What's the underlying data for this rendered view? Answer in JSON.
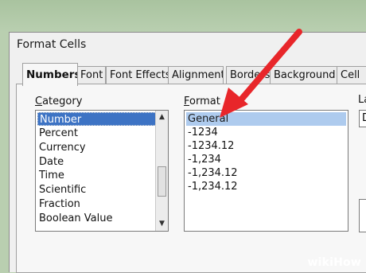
{
  "window": {
    "title": "Format Cells"
  },
  "tabs": [
    {
      "label": "Numbers",
      "active": true
    },
    {
      "label": "Font"
    },
    {
      "label": "Font Effects"
    },
    {
      "label": "Alignment"
    },
    {
      "label": "Borders"
    },
    {
      "label": "Background"
    },
    {
      "label": "Cell"
    }
  ],
  "category": {
    "label_prefix": "",
    "label_underlined": "C",
    "label_rest": "ategory",
    "items": [
      "Number",
      "Percent",
      "Currency",
      "Date",
      "Time",
      "Scientific",
      "Fraction",
      "Boolean Value"
    ],
    "selected_index": 0
  },
  "format": {
    "label_underlined": "F",
    "label_rest": "ormat",
    "items": [
      "General",
      "-1234",
      "-1234.12",
      "-1,234",
      "-1,234.12",
      "-1,234.12"
    ],
    "selected_index": 0
  },
  "language": {
    "label_partial": "La",
    "value_partial": "D"
  },
  "watermark": {
    "text": "wikiHow"
  },
  "colors": {
    "arrow": "#e8262a",
    "selection": "#3d73c4"
  },
  "icons": {
    "scroll_up": "chevron-up-icon",
    "scroll_down": "chevron-down-icon"
  }
}
